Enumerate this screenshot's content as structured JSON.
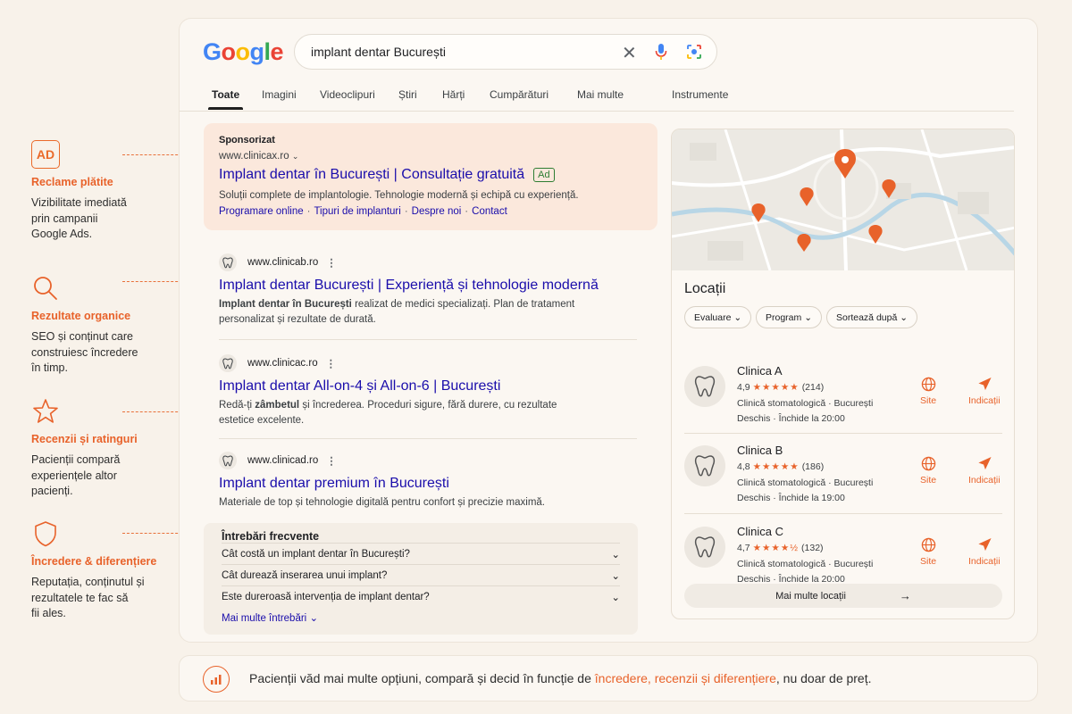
{
  "annotations": [
    {
      "icon": "ad-icon",
      "icon_text": "AD",
      "title": "Reclame plătite",
      "desc": [
        "Vizibilitate imediată",
        "prin campanii",
        "Google Ads."
      ]
    },
    {
      "icon": "search-icon",
      "title": "Rezultate organice",
      "desc": [
        "SEO și conținut care",
        "construiesc încredere",
        "în timp."
      ]
    },
    {
      "icon": "star-icon",
      "title": "Recenzii și ratinguri",
      "desc": [
        "Pacienții compară",
        "experiențele altor",
        "pacienți."
      ]
    },
    {
      "icon": "shield-icon",
      "title": "Încredere & diferențiere",
      "desc": [
        "Reputația, conținutul și",
        "rezultatele te fac să",
        "fii ales."
      ]
    }
  ],
  "logo": "Google",
  "search": {
    "query": "implant dentar București"
  },
  "tabs": [
    "Toate",
    "Imagini",
    "Videoclipuri",
    "Știri",
    "Hărți",
    "Cumpărături",
    "Mai multe",
    "Instrumente"
  ],
  "ad": {
    "label": "Sponsorizat",
    "url": "www.clinicax.ro",
    "title": "Implant dentar în București | Consultație gratuită",
    "badge": "Ad",
    "snippet": "Soluții complete de implantologie. Tehnologie modernă și echipă cu experiență.",
    "sitelinks": [
      "Programare online",
      "Tipuri de implanturi",
      "Despre noi",
      "Contact"
    ]
  },
  "organic": [
    {
      "url": "www.clinicab.ro",
      "title": "Implant dentar București | Experiență și tehnologie modernă",
      "snippet_bold": "Implant dentar în București",
      "snippet_rest": " realizat de medici specializați. Plan de tratament",
      "snippet_line2": "personalizat și rezultate de durată."
    },
    {
      "url": "www.clinicac.ro",
      "title": "Implant dentar All-on-4 și All-on-6 | București",
      "snippet_line1a": "Redă-ți ",
      "snippet_bold": "zâmbetul",
      "snippet_line1b": " și încrederea. Proceduri sigure, fără durere, cu rezultate",
      "snippet_line2": "estetice excelente."
    },
    {
      "url": "www.clinicad.ro",
      "title": "Implant dentar premium în București",
      "snippet": "Materiale de top și tehnologie digitală pentru confort și precizie maximă."
    }
  ],
  "faq": {
    "title": "Întrebări frecvente",
    "items": [
      "Cât costă un implant dentar în București?",
      "Cât durează inserarea unui implant?",
      "Este dureroasă intervenția de implant dentar?"
    ],
    "more": "Mai multe întrebări"
  },
  "panel": {
    "title": "Locații",
    "filters": [
      "Evaluare",
      "Program",
      "Sortează după"
    ],
    "clinics": [
      {
        "name": "Clinica A",
        "rating": "4,9",
        "stars": "★★★★★",
        "reviews": "(214)",
        "type": "Clinică stomatologică · București",
        "hours": "Deschis · Închide la 20:00"
      },
      {
        "name": "Clinica B",
        "rating": "4,8",
        "stars": "★★★★★",
        "reviews": "(186)",
        "type": "Clinică stomatologică · București",
        "hours": "Deschis · Închide la 19:00"
      },
      {
        "name": "Clinica C",
        "rating": "4,7",
        "stars": "★★★★½",
        "reviews": "(132)",
        "type": "Clinică stomatologică · București",
        "hours": "Deschis · Închide la 20:00"
      }
    ],
    "site_label": "Site",
    "directions_label": "Indicații",
    "more": "Mai multe locații"
  },
  "bottom": {
    "text_before": "Pacienții văd mai multe opțiuni, compară și decid în funcție de ",
    "highlight": "încredere, recenzii și diferențiere",
    "text_after": ", nu doar de preț."
  },
  "colors": {
    "accent": "#e8622a",
    "link": "#1a0dab",
    "background": "#f8f2ea"
  }
}
